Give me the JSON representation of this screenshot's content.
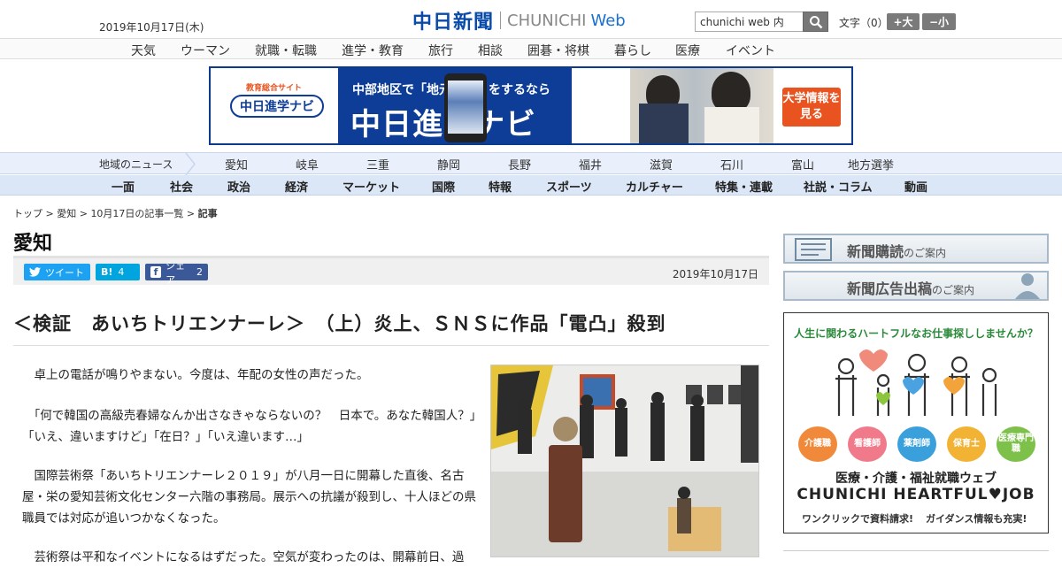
{
  "header": {
    "date": "2019年10月17日(木)",
    "logo_jp": "中日新聞",
    "logo_en": "CHUNICHI",
    "logo_web": "Web",
    "search_value": "chunichi web 内",
    "fontsize_label": "文字（0）",
    "font_large": "+大",
    "font_small": "−小"
  },
  "topnav": [
    "天気",
    "ウーマン",
    "就職・転職",
    "進学・教育",
    "旅行",
    "相談",
    "囲碁・将棋",
    "暮らし",
    "医療",
    "イベント"
  ],
  "banner": {
    "logo_top": "教育総合サイト",
    "logo_text": "中日進学ナビ",
    "headline_top": "中部地区で「地元進学」をするなら",
    "title": "中日進学ナビ",
    "cta": "大学情報を見る"
  },
  "regionnav": {
    "label": "地域のニュース",
    "items": [
      "愛知",
      "岐阜",
      "三重",
      "静岡",
      "長野",
      "福井",
      "滋賀",
      "石川",
      "富山",
      "地方選挙"
    ]
  },
  "sectionnav": [
    "一面",
    "社会",
    "政治",
    "経済",
    "マーケット",
    "国際",
    "特報",
    "スポーツ",
    "カルチャー",
    "特集・連載",
    "社説・コラム",
    "動画"
  ],
  "breadcrumb": {
    "top": "トップ",
    "area": "愛知",
    "list": "10月17日の記事一覧",
    "current": "記事"
  },
  "page_title": "愛知",
  "share": {
    "tweet": "ツイート",
    "hatena_label": "B!",
    "hatena_count": "4",
    "facebook_label": "シェア",
    "facebook_count": "2"
  },
  "article": {
    "date": "2019年10月17日",
    "headline": "＜検証　あいちトリエンナーレ＞　（上）炎上、ＳＮＳに作品「電凸」殺到",
    "paragraphs": [
      "　卓上の電話が鳴りやまない。今度は、年配の女性の声だった。",
      "　「何で韓国の高級売春婦なんか出さなきゃならないの？　日本で。あなた韓国人？」「いえ、違いますけど」「在日？」「いえ違います…」",
      "　国際芸術祭「あいちトリエンナーレ２０１９」が八月一日に開幕した直後、名古屋・栄の愛知芸術文化センター六階の事務局。展示への抗議が殺到し、十人ほどの県職員では対応が追いつかなくなった。",
      "　芸術祭は平和なイベントになるはずだった。空気が変わったのは、開幕前日、過"
    ]
  },
  "sidebar": {
    "subscribe": "新聞購読",
    "subscribe_suffix": "のご案内",
    "advertise": "新聞広告出稿",
    "advertise_suffix": "のご案内",
    "ad": {
      "tagline": "人生に関わるハートフルなお仕事探ししませんか？",
      "pills": [
        "介護職",
        "看護師",
        "薬剤師",
        "保育士",
        "医療専門職"
      ],
      "jp": "医療・介護・福祉就職ウェブ",
      "en": "CHUNICHI HEARTFUL♥JOB",
      "note1": "ワンクリックで資料請求!",
      "note2": "ガイダンス情報も充実!"
    }
  },
  "colors": {
    "brand_blue": "#0a4aa8",
    "twitter": "#1da1f2",
    "hatena": "#00a4de",
    "facebook": "#3b5998",
    "cta_orange": "#e8531f"
  }
}
